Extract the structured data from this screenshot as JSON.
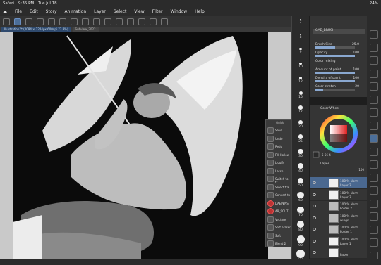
{
  "status": {
    "app": "Safari",
    "time": "9:35 PM",
    "date": "Tue Jul 18",
    "battery": "24%"
  },
  "menu": [
    "File",
    "Edit",
    "Story",
    "Animation",
    "Layer",
    "Select",
    "View",
    "Filter",
    "Window",
    "Help"
  ],
  "subview": {
    "title": "Sub View"
  },
  "tabs": [
    {
      "label": "Illustration7* (2084 × 2224px 600dpi 77.8%)"
    },
    {
      "label": "Subview_2022"
    }
  ],
  "brush_sizes": [
    "7",
    "8",
    "9",
    "10",
    "12",
    "15",
    "17",
    "20",
    "25",
    "30",
    "40",
    "50",
    "60",
    "70",
    "80",
    "90",
    "100"
  ],
  "tool_property": {
    "title": "OAE_BRUSH",
    "brush_size": {
      "label": "Brush Size",
      "value": "25.0",
      "fill": 0.5
    },
    "opacity": {
      "label": "Opacity",
      "value": "100",
      "fill": 1.0
    },
    "color_mixing": {
      "label": "Color mixing"
    },
    "amount_of_paint": {
      "label": "Amount of paint",
      "value": "100",
      "fill": 1.0
    },
    "density_of_paint": {
      "label": "Density of paint",
      "value": "100",
      "fill": 1.0
    },
    "color_stretch": {
      "label": "Color stretch",
      "value": "20",
      "fill": 0.2
    }
  },
  "color_wheel": {
    "title": "Color Wheel",
    "h": "5",
    "s": "56",
    "v": "4"
  },
  "layer_panel": {
    "title": "Layer",
    "opacity": "100",
    "layers": [
      {
        "name": "Layer 2",
        "opacity": "100 % Norm",
        "selected": true,
        "type": "layer"
      },
      {
        "name": "Layer 3",
        "opacity": "100 % Norm",
        "selected": false,
        "type": "layer"
      },
      {
        "name": "Folder 2",
        "opacity": "100 % Norm",
        "selected": false,
        "type": "folder"
      },
      {
        "name": "wings",
        "opacity": "100 % Norm",
        "selected": false,
        "type": "folder"
      },
      {
        "name": "Folder 1",
        "opacity": "100 % Norm",
        "selected": false,
        "type": "folder"
      },
      {
        "name": "Layer 1",
        "opacity": "100 % Norm",
        "selected": false,
        "type": "layer"
      },
      {
        "name": "Paper",
        "opacity": "",
        "selected": false,
        "type": "paper"
      }
    ]
  },
  "quick_access": {
    "title": "Quick",
    "items": [
      "Save",
      "Undo",
      "Redo",
      "Fill Hollow",
      "Liquify",
      "Lasso",
      "Switch to tr",
      "Select tra",
      "Convert to",
      "DAEPENS",
      "AB_SOUT",
      "Vectorer",
      "Soft eraser",
      "Soft",
      "Blend 2"
    ]
  },
  "colors": {
    "accent": "#4a6890",
    "panel": "#353535",
    "bg": "#1e1e1e"
  }
}
